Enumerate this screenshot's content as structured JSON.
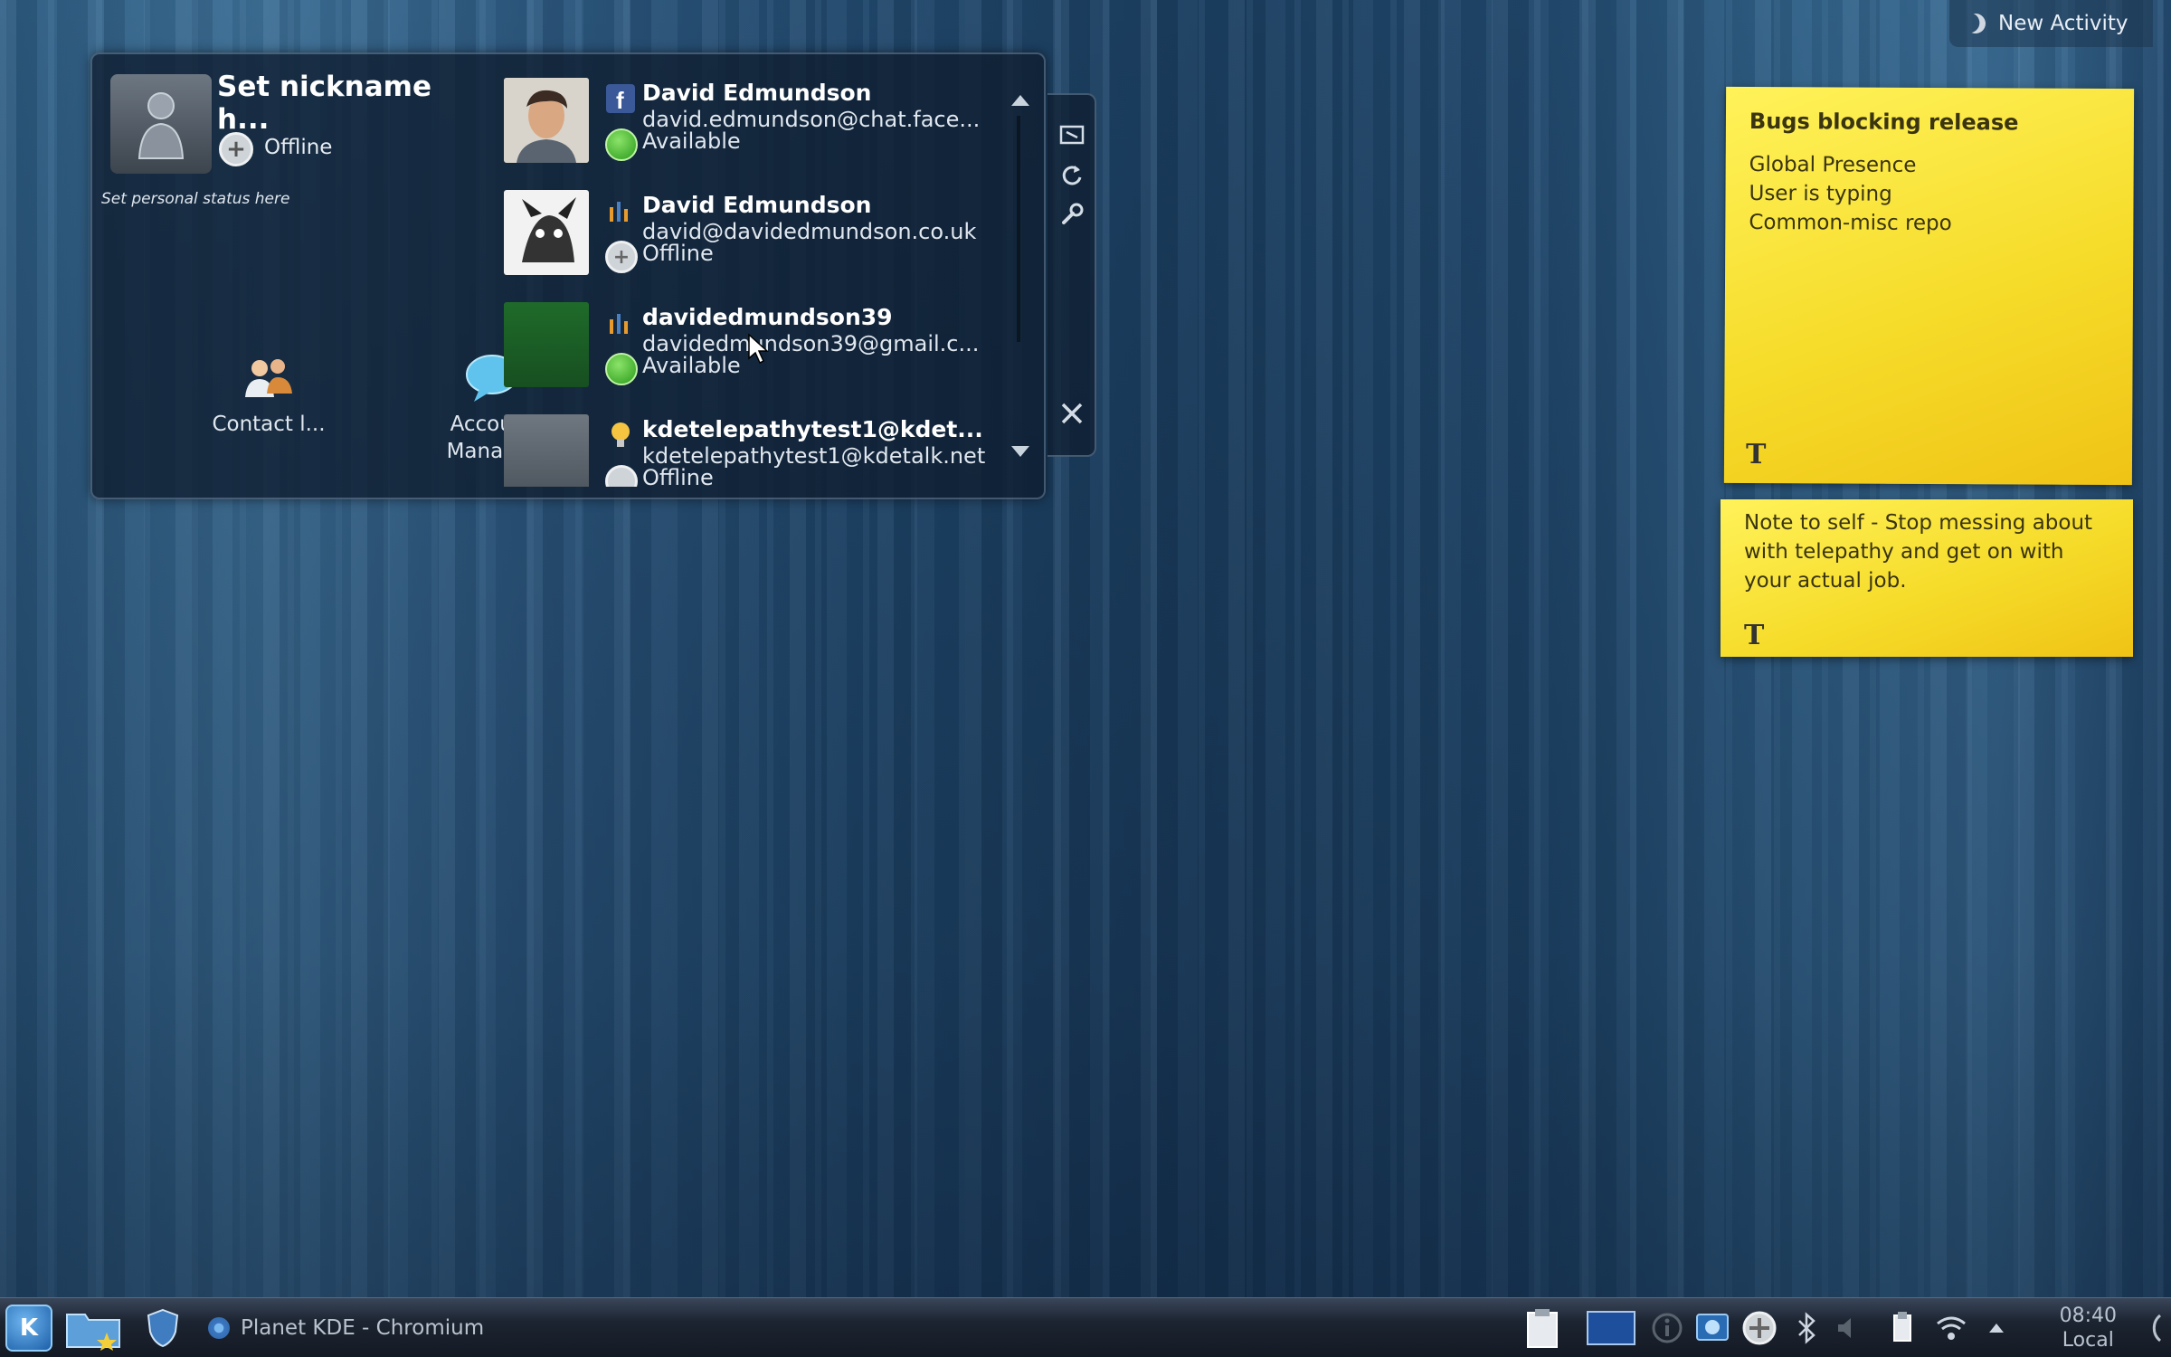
{
  "activity": {
    "label": "New Activity"
  },
  "telepathy": {
    "nickname": "Set nickname h...",
    "my_status": "Offline",
    "personal_status": "Set personal status here",
    "launchers": [
      {
        "label": "Contact l...",
        "icon": "contacts-icon"
      },
      {
        "label_line1": "Account",
        "label_line2": "Manager",
        "icon": "chat-bubble-icon"
      }
    ],
    "contacts": [
      {
        "name": "David Edmundson",
        "address": "david.edmundson@chat.face...",
        "status": "Available",
        "protocol": "facebook-icon",
        "presence": "available"
      },
      {
        "name": "David Edmundson",
        "address": "david@davidedmundson.co.uk",
        "status": "Offline",
        "protocol": "jabber-icon",
        "presence": "offline"
      },
      {
        "name": "davidedmundson39",
        "address": "davidedmundson39@gmail.c...",
        "status": "Available",
        "protocol": "jabber-icon",
        "presence": "available"
      },
      {
        "name": "kdetelepathytest1@kdet...",
        "address": "kdetelepathytest1@kdetalk.net",
        "status": "Offline",
        "protocol": "lightbulb-icon",
        "presence": "offline"
      }
    ]
  },
  "notes": [
    {
      "title": "Bugs blocking release",
      "lines": [
        "Global Presence",
        "User is typing",
        "Common-misc repo"
      ]
    },
    {
      "lines": [
        "Note to self - Stop messing about",
        "with telepathy and get on with",
        "your actual job."
      ]
    }
  ],
  "taskbar": {
    "task_label": "Planet KDE - Chromium",
    "clock_time": "08:40",
    "clock_zone": "Local"
  },
  "colors": {
    "note_yellow": "#f6dc2a",
    "available_green": "#2a9b1a",
    "desktop_blue": "#20476b"
  }
}
